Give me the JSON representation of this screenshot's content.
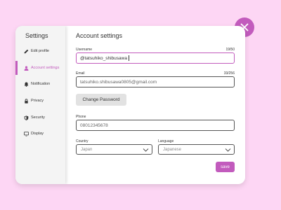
{
  "colors": {
    "background": "#fdd6f4",
    "accent": "#c25bbd",
    "card": "#ffffff",
    "sidebar": "#f4f4f4"
  },
  "close_button": {
    "icon": "close-icon"
  },
  "sidebar": {
    "title": "Settings",
    "items": [
      {
        "label": "Edit profile",
        "icon": "edit-pencil-icon",
        "active": false
      },
      {
        "label": "Account settings",
        "icon": "user-icon",
        "active": true
      },
      {
        "label": "Notification",
        "icon": "bell-icon",
        "active": false
      },
      {
        "label": "Privacy",
        "icon": "lock-icon",
        "active": false
      },
      {
        "label": "Security",
        "icon": "shield-icon",
        "active": false
      },
      {
        "label": "Display",
        "icon": "monitor-icon",
        "active": false
      }
    ]
  },
  "main": {
    "title": "Account settings",
    "username": {
      "label": "Username",
      "count": "19/50",
      "value": "@tatsuhiko_shibusawa"
    },
    "email": {
      "label": "Email",
      "count": "33/256",
      "value": "tatsuhiko.shibusawa0805@gmail.com"
    },
    "change_password_label": "Change Password",
    "phone": {
      "label": "Phone",
      "value": "08012345678"
    },
    "country": {
      "label": "Country",
      "value": "Japan"
    },
    "language": {
      "label": "Language",
      "value": "Japanese"
    },
    "save_label": "save"
  }
}
